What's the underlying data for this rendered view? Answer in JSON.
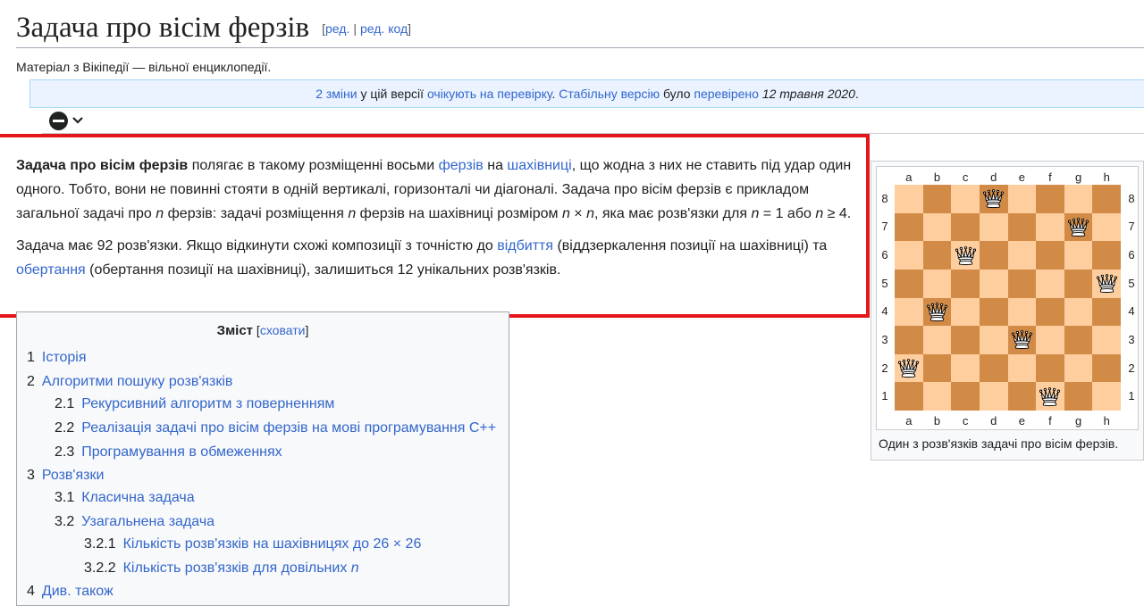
{
  "heading": {
    "title": "Задача про вісім ферзів",
    "bracket_open": "[",
    "edit": "ред.",
    "separator": "|",
    "edit_source": "ред. код",
    "bracket_close": "]"
  },
  "site_sub": "Матеріал з Вікіпедії — вільної енциклопедії.",
  "flagged": {
    "changes_link": "2 зміни",
    "t1": " у цій версії ",
    "pending_link": "очікують на перевірку",
    "t2": ". ",
    "stable_link": "Стабільну версію",
    "t3": " було ",
    "checked_link": "перевірено",
    "t4": " ",
    "date": "12 травня 2020",
    "t5": "."
  },
  "tools": {
    "icon": "minus-circle-icon",
    "chevron": "chevron-down-icon"
  },
  "lead": {
    "p1": {
      "bold": "Задача про вісім ферзів",
      "t1": " полягає в такому розміщенні восьми ",
      "link1": "ферзів",
      "t2": " на ",
      "link2": "шахівниці",
      "t3": ", що жодна з них не ставить під удар один одного. Тобто, вони не повинні стояти в одній вертикалі, горизонталі чи діагоналі. Задача про вісім ферзів є прикладом загальної задачі про ",
      "n1": "n",
      "t4": " ферзів: задачі розміщення ",
      "n2": "n",
      "t5": " ферзів на шахівниці розміром ",
      "n3": "n",
      "t6": " × ",
      "n4": "n",
      "t7": ", яка має розв'язки для ",
      "n5": "n",
      "t8": " = 1 або ",
      "n6": "n",
      "t9": " ≥ 4."
    },
    "p2": {
      "t1": "Задача має 92 розв'язки. Якщо відкинути схожі композиції з точністю до ",
      "link1": "відбиття",
      "t2": " (віддзеркалення позиції на шахівниці) та ",
      "link2": "обертання",
      "t3": " (обертання позиції на шахівниці), залишиться 12 унікальних розв'язків."
    }
  },
  "toc": {
    "title": "Зміст",
    "toggle_open": " [",
    "toggle": "сховати",
    "toggle_close": "]",
    "items": [
      {
        "num": "1",
        "label": "Історія",
        "level": 1
      },
      {
        "num": "2",
        "label": "Алгоритми пошуку розв'язків",
        "level": 1
      },
      {
        "num": "2.1",
        "label": "Рекурсивний алгоритм з поверненням",
        "level": 2
      },
      {
        "num": "2.2",
        "label": "Реалізація задачі про вісім ферзів на мові програмування C++",
        "level": 2
      },
      {
        "num": "2.3",
        "label": "Програмування в обмеженнях",
        "level": 2
      },
      {
        "num": "3",
        "label": "Розв'язки",
        "level": 1
      },
      {
        "num": "3.1",
        "label": "Класична задача",
        "level": 2
      },
      {
        "num": "3.2",
        "label": "Узагальнена задача",
        "level": 2
      },
      {
        "num": "3.2.1",
        "label": "Кількість розв'язків на шахівницях до 26 × 26",
        "level": 3
      },
      {
        "num": "3.2.2",
        "label": "Кількість розв'язків для довільних ",
        "italic": "n",
        "level": 3
      },
      {
        "num": "4",
        "label": "Див. також",
        "level": 1
      }
    ]
  },
  "board": {
    "files": [
      "a",
      "b",
      "c",
      "d",
      "e",
      "f",
      "g",
      "h"
    ],
    "ranks": [
      "8",
      "7",
      "6",
      "5",
      "4",
      "3",
      "2",
      "1"
    ],
    "queens": [
      {
        "file": "d",
        "rank": "8"
      },
      {
        "file": "g",
        "rank": "7"
      },
      {
        "file": "c",
        "rank": "6"
      },
      {
        "file": "h",
        "rank": "5"
      },
      {
        "file": "b",
        "rank": "4"
      },
      {
        "file": "e",
        "rank": "3"
      },
      {
        "file": "a",
        "rank": "2"
      },
      {
        "file": "f",
        "rank": "1"
      }
    ],
    "light_color": "#ffce9e",
    "dark_color": "#d18b47",
    "piece": "white-queen-icon",
    "caption": "Один з розв'язків задачі про вісім ферзів."
  },
  "colors": {
    "link": "#3366cc",
    "highlight": "#e3161b",
    "flagged_bg": "#eaf3ff"
  }
}
